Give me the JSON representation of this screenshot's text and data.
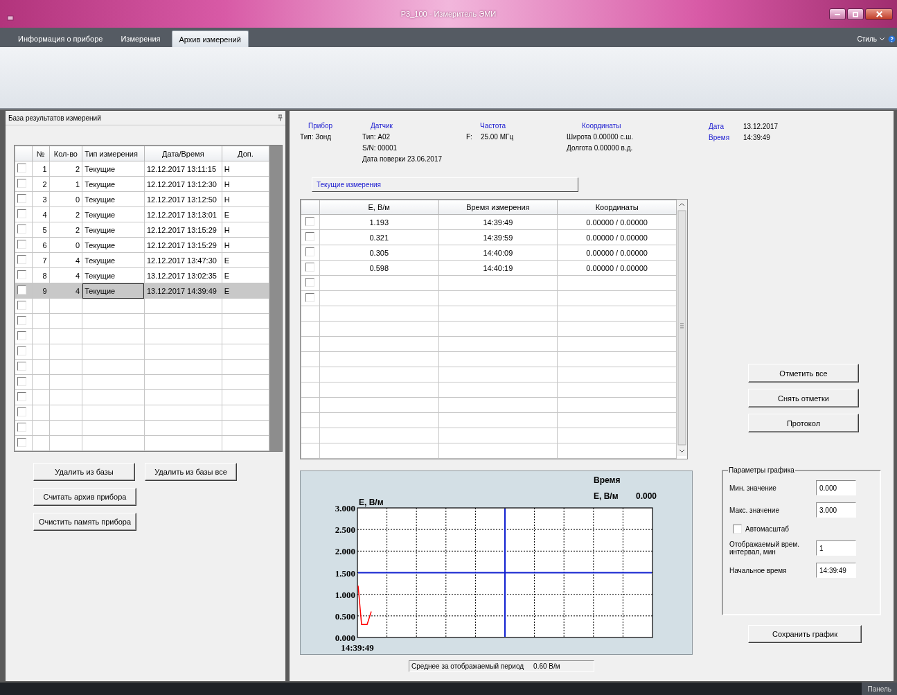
{
  "window": {
    "title": "Р3_100 - Измеритель ЭМИ"
  },
  "tabs": [
    {
      "label": "Информация о приборе",
      "selected": false
    },
    {
      "label": "Измерения",
      "selected": false
    },
    {
      "label": "Архив измерений",
      "selected": true
    }
  ],
  "style_menu": {
    "label": "Стиль"
  },
  "database_panel": {
    "title": "База результатов измерений",
    "columns": [
      "№",
      "Кол-во",
      "Тип измерения",
      "Дата/Время",
      "Доп."
    ],
    "rows": [
      {
        "cells": [
          "1",
          "2",
          "Текущие",
          "12.12.2017 13:11:15",
          "Н"
        ],
        "checked": false,
        "selected": false
      },
      {
        "cells": [
          "2",
          "1",
          "Текущие",
          "12.12.2017 13:12:30",
          "Н"
        ],
        "checked": false,
        "selected": false
      },
      {
        "cells": [
          "3",
          "0",
          "Текущие",
          "12.12.2017 13:12:50",
          "Н"
        ],
        "checked": false,
        "selected": false
      },
      {
        "cells": [
          "4",
          "2",
          "Текущие",
          "12.12.2017 13:13:01",
          "Е"
        ],
        "checked": false,
        "selected": false
      },
      {
        "cells": [
          "5",
          "2",
          "Текущие",
          "12.12.2017 13:15:29",
          "Н"
        ],
        "checked": false,
        "selected": false
      },
      {
        "cells": [
          "6",
          "0",
          "Текущие",
          "12.12.2017 13:15:29",
          "Н"
        ],
        "checked": false,
        "selected": false
      },
      {
        "cells": [
          "7",
          "4",
          "Текущие",
          "12.12.2017 13:47:30",
          "Е"
        ],
        "checked": false,
        "selected": false
      },
      {
        "cells": [
          "8",
          "4",
          "Текущие",
          "13.12.2017 13:02:35",
          "Е"
        ],
        "checked": false,
        "selected": false
      },
      {
        "cells": [
          "9",
          "4",
          "Текущие",
          "13.12.2017 14:39:49",
          "Е"
        ],
        "checked": false,
        "selected": true
      }
    ],
    "empty_rows": [
      {
        "checked": false
      },
      {
        "checked": false
      },
      {
        "checked": false
      },
      {
        "checked": false
      },
      {
        "checked": false
      },
      {
        "checked": false
      },
      {
        "checked": false
      },
      {
        "checked": false
      },
      {
        "checked": false
      },
      {
        "checked": false
      }
    ]
  },
  "database_buttons": [
    "Удалить из базы",
    "Удалить из базы все",
    "Считать архив прибора",
    "Очистить память прибора"
  ],
  "device_info": {
    "device": {
      "label": "Прибор",
      "lines": [
        "Тип: Зонд"
      ]
    },
    "sensor": {
      "label": "Датчик",
      "lines": [
        "Тип: А02",
        "S/N: 00001",
        "Дата поверки 23.06.2017"
      ]
    },
    "frequency": {
      "label": "Частота",
      "prefix": "F:",
      "value": "25.00 МГц"
    },
    "coordinates": {
      "label": "Координаты",
      "lines": [
        "Широта 0.00000 с.ш.",
        "Долгота 0.00000 в.д."
      ]
    },
    "date": {
      "label": "Дата",
      "value": "13.12.2017"
    },
    "time": {
      "label": "Время",
      "value": "14:39:49"
    }
  },
  "measurements": {
    "title": "Текущие измерения",
    "columns": [
      "E, В/м",
      "Время измерения",
      "Координаты"
    ],
    "rows": [
      {
        "cells": [
          "1.193",
          "14:39:49",
          "0.00000 / 0.00000"
        ],
        "checked": false
      },
      {
        "cells": [
          "0.321",
          "14:39:59",
          "0.00000 / 0.00000"
        ],
        "checked": false
      },
      {
        "cells": [
          "0.305",
          "14:40:09",
          "0.00000 / 0.00000"
        ],
        "checked": false
      },
      {
        "cells": [
          "0.598",
          "14:40:19",
          "0.00000 / 0.00000"
        ],
        "checked": false
      }
    ],
    "empty_rows": [
      {
        "checked": false
      },
      {
        "checked": false
      }
    ]
  },
  "action_buttons": [
    "Отметить все",
    "Снять отметки",
    "Протокол"
  ],
  "chart": {
    "cursor_label": "Время",
    "readout_label": "E, В/м",
    "readout_value": "0.000",
    "y_axis_label": "E, В/м",
    "y_tick_labels": [
      "3.000",
      "2.500",
      "2.000",
      "1.500",
      "1.000",
      "0.500",
      "0.000"
    ],
    "x_axis_label": "14:39:49",
    "average": {
      "label": "Среднее за отображаемый период",
      "value": "0.60 В/м"
    }
  },
  "chart_params": {
    "title": "Параметры графика",
    "items": [
      {
        "kind": "field",
        "label": "Мин. значение",
        "value": "0.000"
      },
      {
        "kind": "field",
        "label": "Макс. значение",
        "value": "3.000"
      },
      {
        "kind": "checkbox",
        "label": "Автомасштаб",
        "checked": false
      },
      {
        "kind": "field",
        "label": "Отображаемый врем. интервал, мин",
        "value": "1"
      },
      {
        "kind": "field",
        "label": "Начальное время",
        "value": "14:39:49"
      }
    ],
    "save_button": "Сохранить график"
  },
  "status_bar": {
    "panel_label": "Панель"
  }
}
